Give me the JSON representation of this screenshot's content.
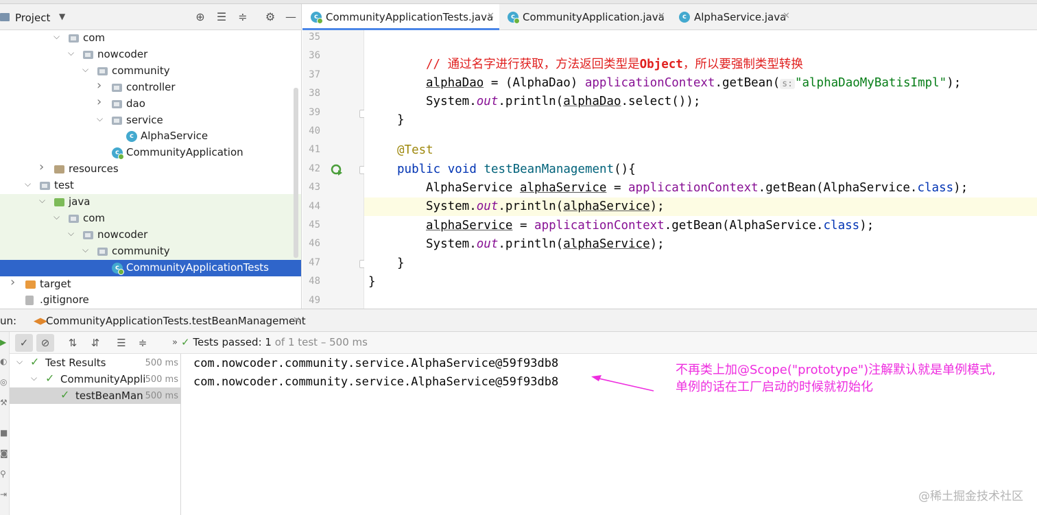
{
  "project_pane": {
    "title": "Project",
    "tree": [
      {
        "label": "com",
        "kind": "folder",
        "depth": 0,
        "arrow": "expanded"
      },
      {
        "label": "nowcoder",
        "kind": "folder",
        "depth": 1,
        "arrow": "expanded"
      },
      {
        "label": "community",
        "kind": "folder",
        "depth": 2,
        "arrow": "expanded"
      },
      {
        "label": "controller",
        "kind": "folder",
        "depth": 3,
        "arrow": "collapsed"
      },
      {
        "label": "dao",
        "kind": "folder",
        "depth": 3,
        "arrow": "collapsed"
      },
      {
        "label": "service",
        "kind": "folder",
        "depth": 3,
        "arrow": "expanded"
      },
      {
        "label": "AlphaService",
        "kind": "class",
        "depth": 4
      },
      {
        "label": "CommunityApplication",
        "kind": "spring-class",
        "depth": 3
      },
      {
        "label": "resources",
        "kind": "resources-folder",
        "depth": -1,
        "arrow": "collapsed"
      },
      {
        "label": "test",
        "kind": "folder",
        "depth": -2,
        "arrow": "expanded"
      },
      {
        "label": "java",
        "kind": "test-folder",
        "depth": -1,
        "arrow": "expanded"
      },
      {
        "label": "com",
        "kind": "folder",
        "depth": 0,
        "arrow": "expanded"
      },
      {
        "label": "nowcoder",
        "kind": "folder",
        "depth": 1,
        "arrow": "expanded"
      },
      {
        "label": "community",
        "kind": "folder",
        "depth": 2,
        "arrow": "expanded"
      },
      {
        "label": "CommunityApplicationTests",
        "kind": "spring-class",
        "depth": 3
      },
      {
        "label": "target",
        "kind": "output-folder",
        "depth": -3,
        "arrow": "collapsed"
      },
      {
        "label": ".gitignore",
        "kind": "file",
        "depth": -3
      }
    ]
  },
  "editor": {
    "tabs": [
      {
        "label": "CommunityApplicationTests.java",
        "active": true
      },
      {
        "label": "CommunityApplication.java",
        "active": false
      },
      {
        "label": "AlphaService.java",
        "active": false
      }
    ],
    "line_numbers": [
      "35",
      "36",
      "37",
      "38",
      "39",
      "40",
      "41",
      "42",
      "43",
      "44",
      "45",
      "46",
      "47",
      "48",
      "49"
    ],
    "code": {
      "l36_comment": "// 通过名字进行获取，方法返回类型是",
      "l36_object": "Object",
      "l36_comment2": "，所以要强制类型转换",
      "l37_a": "alphaDao",
      "l37_b": " = (AlphaDao) ",
      "l37_ctx": "applicationContext",
      "l37_c": ".getBean(",
      "l37_hint": "s:",
      "l37_str": "\"alphaDaoMyBatisImpl\"",
      "l37_d": ");",
      "l38_a": "System.",
      "l38_out": "out",
      "l38_b": ".println(",
      "l38_var": "alphaDao",
      "l38_c": ".select());",
      "l39": "}",
      "l41": "@Test",
      "l42_kw1": "public",
      "l42_kw2": "void",
      "l42_m": "testBeanManagement",
      "l42_rest": "(){",
      "l43_a": "AlphaService ",
      "l43_var": "alphaService",
      "l43_b": " = ",
      "l43_ctx": "applicationContext",
      "l43_c": ".getBean(AlphaService.",
      "l43_cls": "class",
      "l43_d": ");",
      "l44_a": "System.",
      "l44_out": "out",
      "l44_b": ".println(",
      "l44_var": "alphaService",
      "l44_c": ");",
      "l45_var": "alphaService",
      "l45_b": " = ",
      "l45_ctx": "applicationContext",
      "l45_c": ".getBean(AlphaService.",
      "l45_cls": "class",
      "l45_d": ");",
      "l46_a": "System.",
      "l46_out": "out",
      "l46_b": ".println(",
      "l46_var": "alphaService",
      "l46_c": ");",
      "l47": "}",
      "l48": "}"
    }
  },
  "run_panel": {
    "label": "un:",
    "tab_label": "CommunityApplicationTests.testBeanManagement",
    "status_main": "Tests passed: 1",
    "status_sub": " of 1 test – 500 ms",
    "results": [
      {
        "label": "Test Results",
        "time": "500 ms"
      },
      {
        "label": "CommunityApplic",
        "time": "500 ms"
      },
      {
        "label": "testBeanManag",
        "time": "500 ms"
      }
    ],
    "console_lines": [
      "com.nowcoder.community.service.AlphaService@59f93db8",
      "com.nowcoder.community.service.AlphaService@59f93db8"
    ]
  },
  "annotation": {
    "line1": "不再类上加@Scope(\"prototype\")注解默认就是单例模式,",
    "line2": "单例的话在工厂启动的时候就初始化",
    "color": "#ee2ddf"
  },
  "watermark": "@稀土掘金技术社区",
  "colors": {
    "selection": "#2f65ca",
    "keyword": "#0033b3",
    "string": "#067d17",
    "comment": "#e0201f",
    "pass": "#4a9e3a"
  }
}
